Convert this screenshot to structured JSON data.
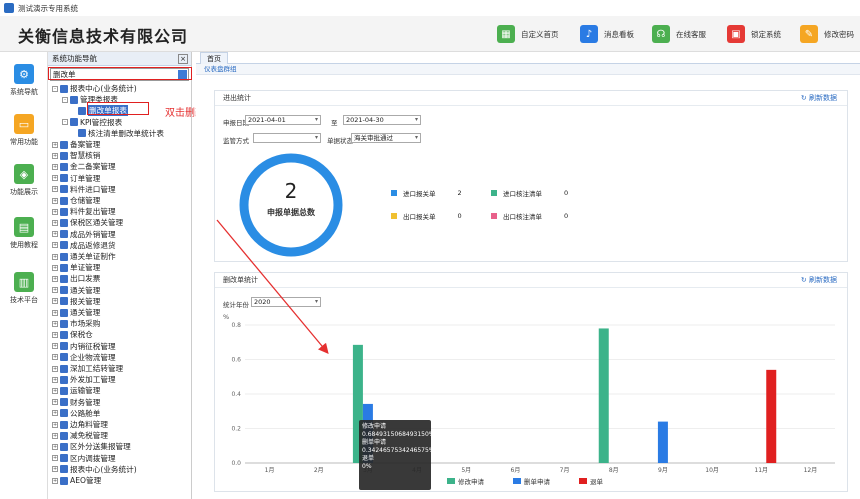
{
  "window": {
    "title": "测试演示专用系统"
  },
  "header": {
    "company": "关衡信息技术有限公司",
    "buttons": [
      {
        "label": "自定义首页",
        "icon": "grid-icon",
        "color": "#4caf50"
      },
      {
        "label": "消息看板",
        "icon": "bell-icon",
        "color": "#2a7be4"
      },
      {
        "label": "在线客服",
        "icon": "headset-icon",
        "color": "#4caf50"
      },
      {
        "label": "锁定系统",
        "icon": "lock-icon",
        "color": "#e53935"
      },
      {
        "label": "修改密码",
        "icon": "edit-icon",
        "color": "#f5a623"
      }
    ]
  },
  "leftbar": {
    "items": [
      {
        "label": "系统导航",
        "icon": "gear-icon",
        "color": "#2a8de4"
      },
      {
        "label": "常用功能",
        "icon": "folder-icon",
        "color": "#f5a623"
      },
      {
        "label": "功能展示",
        "icon": "cube-icon",
        "color": "#4caf50"
      },
      {
        "label": "使用教程",
        "icon": "book-icon",
        "color": "#4caf50"
      },
      {
        "label": "技术平台",
        "icon": "doc-icon",
        "color": "#4caf50"
      }
    ]
  },
  "nav": {
    "title": "系统功能导航",
    "close": "×",
    "search_value": "删改单",
    "tree": [
      {
        "label": "报表中心(业务统计)",
        "level": 1,
        "pm": "-"
      },
      {
        "label": "管理类报表",
        "level": 2,
        "pm": "-"
      },
      {
        "label": "删改单报表",
        "level": 3,
        "pm": ""
      },
      {
        "label": "KPI管控报表",
        "level": 2,
        "pm": "-"
      },
      {
        "label": "核注清单删改单统计表",
        "level": 3,
        "pm": ""
      },
      {
        "label": "备案管理",
        "level": 1,
        "pm": "+"
      },
      {
        "label": "智慧核销",
        "level": 1,
        "pm": "+"
      },
      {
        "label": "金二备案管理",
        "level": 1,
        "pm": "+"
      },
      {
        "label": "订单管理",
        "level": 1,
        "pm": "+"
      },
      {
        "label": "料件进口管理",
        "level": 1,
        "pm": "+"
      },
      {
        "label": "仓储管理",
        "level": 1,
        "pm": "+"
      },
      {
        "label": "料件复出管理",
        "level": 1,
        "pm": "+"
      },
      {
        "label": "保税区通关管理",
        "level": 1,
        "pm": "+"
      },
      {
        "label": "成品外销管理",
        "level": 1,
        "pm": "+"
      },
      {
        "label": "成品返修退货",
        "level": 1,
        "pm": "+"
      },
      {
        "label": "通关单证制作",
        "level": 1,
        "pm": "+"
      },
      {
        "label": "单证管理",
        "level": 1,
        "pm": "+"
      },
      {
        "label": "出口发票",
        "level": 1,
        "pm": "+"
      },
      {
        "label": "通关管理",
        "level": 1,
        "pm": "+"
      },
      {
        "label": "报关管理",
        "level": 1,
        "pm": "+"
      },
      {
        "label": "通关管理",
        "level": 1,
        "pm": "+"
      },
      {
        "label": "市场采购",
        "level": 1,
        "pm": "+"
      },
      {
        "label": "保税仓",
        "level": 1,
        "pm": "+"
      },
      {
        "label": "内销征税管理",
        "level": 1,
        "pm": "+"
      },
      {
        "label": "企业物流管理",
        "level": 1,
        "pm": "+"
      },
      {
        "label": "深加工结转管理",
        "level": 1,
        "pm": "+"
      },
      {
        "label": "外发加工管理",
        "level": 1,
        "pm": "+"
      },
      {
        "label": "运输管理",
        "level": 1,
        "pm": "+"
      },
      {
        "label": "财务管理",
        "level": 1,
        "pm": "+"
      },
      {
        "label": "公路舱单",
        "level": 1,
        "pm": "+"
      },
      {
        "label": "边角料管理",
        "level": 1,
        "pm": "+"
      },
      {
        "label": "减免税管理",
        "level": 1,
        "pm": "+"
      },
      {
        "label": "区外分送集报管理",
        "level": 1,
        "pm": "+"
      },
      {
        "label": "区内调拨管理",
        "level": 1,
        "pm": "+"
      },
      {
        "label": "报表中心(业务统计)",
        "level": 1,
        "pm": "+"
      },
      {
        "label": "AEO管理",
        "level": 1,
        "pm": "+"
      }
    ]
  },
  "annotation": "双击删改单报表",
  "main": {
    "tab": "首页",
    "subtab": "仪表盘群组",
    "panel1": {
      "title": "进出统计",
      "refresh": "刷新数据",
      "date_label": "申报日期",
      "date_from": "2021-04-01",
      "to_label": "至",
      "date_to": "2021-04-30",
      "mode_label": "监管方式",
      "mode_value": "",
      "status_label": "单据状态",
      "status_value": "海关审批通过",
      "total_num": "2",
      "total_label": "申报单据总数",
      "legend": [
        {
          "label": "进口报关单",
          "count": "2",
          "color": "#2a8de4"
        },
        {
          "label": "进口核注清单",
          "count": "0",
          "color": "#3cb38a"
        },
        {
          "label": "出口报关单",
          "count": "0",
          "color": "#f0c030"
        },
        {
          "label": "出口核注清单",
          "count": "0",
          "color": "#e8608a"
        }
      ]
    },
    "panel2": {
      "title": "删改单统计",
      "refresh": "刷新数据",
      "year_label": "统计年份",
      "year_value": "2020",
      "unit": "%"
    },
    "tooltip": {
      "line1": "修改申请",
      "line2": "0.6849315068493150%",
      "line3": "删单申请",
      "line4": "0.3424657534246575%",
      "line5": "退单",
      "line6": "0%"
    }
  },
  "chart_data": {
    "type": "bar",
    "categories": [
      "1月",
      "2月",
      "3月",
      "4月",
      "5月",
      "6月",
      "7月",
      "8月",
      "9月",
      "10月",
      "11月",
      "12月"
    ],
    "series": [
      {
        "name": "修改申请",
        "color": "#3cb38a",
        "values": [
          0,
          0,
          0.6849,
          0,
          0,
          0,
          0,
          0.78,
          0,
          0,
          0,
          0
        ]
      },
      {
        "name": "删单申请",
        "color": "#2a7be4",
        "values": [
          0,
          0,
          0.3425,
          0,
          0,
          0,
          0,
          0,
          0.24,
          0,
          0,
          0
        ]
      },
      {
        "name": "退单",
        "color": "#e02020",
        "values": [
          0,
          0,
          0,
          0,
          0,
          0,
          0,
          0,
          0,
          0,
          0.54,
          0
        ]
      }
    ],
    "ylabel": "%",
    "yticks": [
      0,
      0.2,
      0.4,
      0.6,
      0.8
    ],
    "ylim": [
      0,
      0.8
    ],
    "legend_position": "bottom"
  }
}
